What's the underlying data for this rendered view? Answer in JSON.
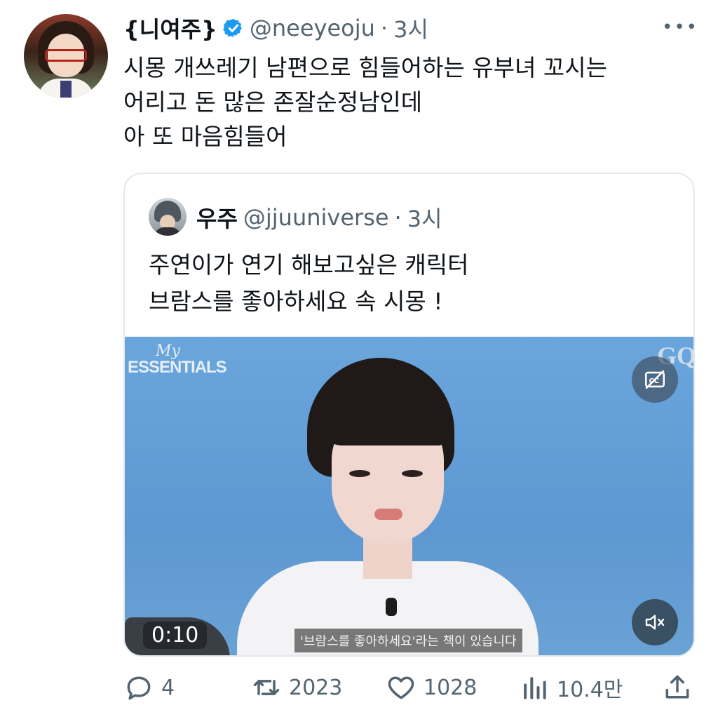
{
  "tweet": {
    "display_name": "{니여주}",
    "handle": "@neeyeoju",
    "separator": "·",
    "time": "3시",
    "more_label": "•••",
    "lines": [
      "시몽 개쓰레기 남편으로 힘들어하는 유부녀 꼬시는",
      "어리고 돈 많은 존잘순정남인데",
      "아 또 마음힘들어"
    ]
  },
  "quote": {
    "display_name": "우주",
    "handle": "@jjuuniverse",
    "separator": "·",
    "time": "3시",
    "lines": [
      "주연이가 연기 해보고싶은 캐릭터",
      "브람스를 좋아하세요 속 시몽 !"
    ],
    "video": {
      "brand_top": "My",
      "brand_bottom": "ESSENTIALS",
      "brand_right": "GQ",
      "duration": "0:10",
      "subtitle": "'브람스를 좋아하세요'라는 책이 있습니다",
      "icons": [
        "closed-captions-off-icon",
        "mute-icon"
      ]
    }
  },
  "actions": {
    "reply_count": "4",
    "retweet_count": "2023",
    "like_count": "1028",
    "views_count": "10.4만",
    "icons": [
      "reply-icon",
      "retweet-icon",
      "like-icon",
      "views-icon",
      "share-icon"
    ]
  },
  "colors": {
    "text": "#0f1419",
    "muted": "#536471",
    "verified": "#1d9bf0",
    "video_bg": "#5f9cd6",
    "border": "#e4e8eb"
  }
}
